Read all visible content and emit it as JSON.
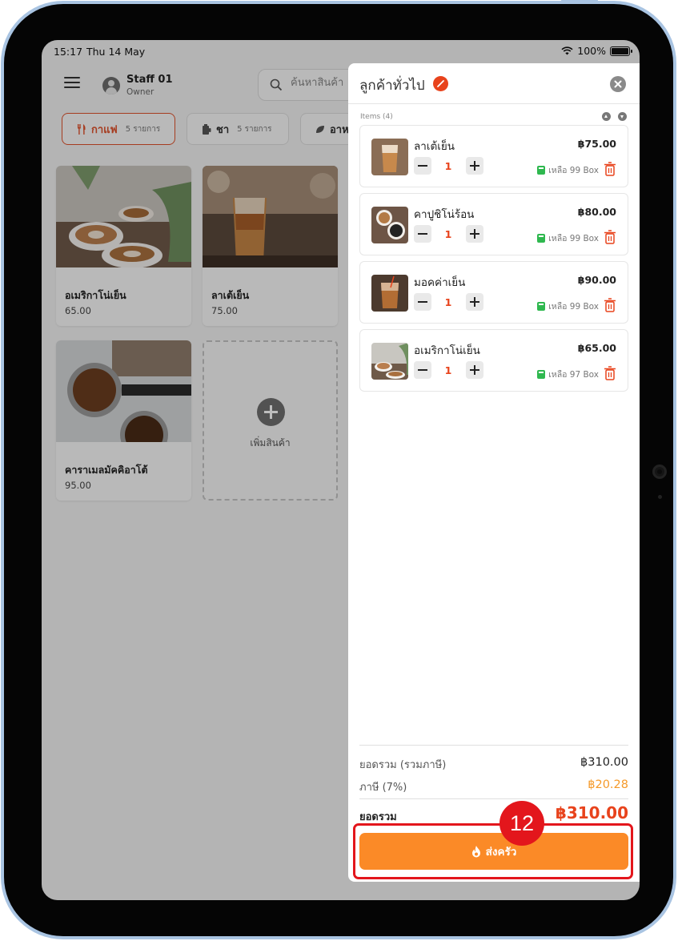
{
  "status_bar": {
    "time": "15:17",
    "date": "Thu 14 May",
    "battery": "100%"
  },
  "header": {
    "staff_name": "Staff 01",
    "staff_role": "Owner",
    "search_placeholder": "ค้นหาสินค้า"
  },
  "categories": [
    {
      "label": "กาแฟ",
      "count": "5 รายการ",
      "icon": "fork-knife-icon",
      "active": true
    },
    {
      "label": "ชา",
      "count": "5 รายการ",
      "icon": "tea-icon",
      "active": false
    },
    {
      "label": "อาหาร",
      "count": "",
      "icon": "leaf-icon",
      "active": false
    }
  ],
  "products": [
    {
      "name": "อเมริกาโน่เย็น",
      "price": "65.00"
    },
    {
      "name": "ลาเต้เย็น",
      "price": "75.00"
    },
    {
      "name": "คาราเมลมัคคิอาโต้",
      "price": "95.00"
    }
  ],
  "add_product_label": "เพิ่มสินค้า",
  "cart": {
    "title": "ลูกค้าทั่วไป",
    "items_label": "Items (4)",
    "items": [
      {
        "name": "ลาเต้เย็น",
        "price": "฿75.00",
        "qty": "1",
        "stock": "เหลือ 99 Box"
      },
      {
        "name": "คาปูชิโน่ร้อน",
        "price": "฿80.00",
        "qty": "1",
        "stock": "เหลือ 99 Box"
      },
      {
        "name": "มอคค่าเย็น",
        "price": "฿90.00",
        "qty": "1",
        "stock": "เหลือ 99 Box"
      },
      {
        "name": "อเมริกาโน่เย็น",
        "price": "฿65.00",
        "qty": "1",
        "stock": "เหลือ 97 Box"
      }
    ],
    "subtotal_label": "ยอดรวม (รวมภาษี)",
    "subtotal_value": "฿310.00",
    "tax_label": "ภาษี (7%)",
    "tax_value": "฿20.28",
    "grand_total_label": "ยอดรวม",
    "grand_total_value": "฿310.00",
    "send_button_label": "ส่งครัว"
  },
  "annotation": {
    "step_number": "12"
  },
  "colors": {
    "accent": "#e8431c",
    "button": "#fb8a27",
    "stock_icon": "#2fb84f",
    "tax_value": "#f59a2a",
    "annotation": "#e3161c"
  }
}
